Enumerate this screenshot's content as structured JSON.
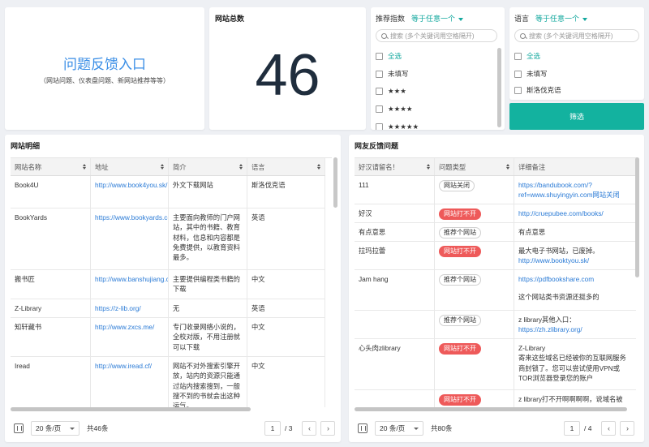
{
  "feedback": {
    "title": "问题反馈入口",
    "subtitle": "（网站问题、仪表盘问题、新网站推荐等等）"
  },
  "total": {
    "title": "网站总数",
    "value": "46"
  },
  "filter_rec": {
    "label": "推荐指数",
    "operator": "等于任意一个",
    "search_placeholder": "搜索 (多个关键词用空格隔开)",
    "options": [
      "全选",
      "未填写",
      "★★★",
      "★★★★",
      "★★★★★"
    ]
  },
  "filter_lang": {
    "label": "语言",
    "operator": "等于任意一个",
    "search_placeholder": "搜索 (多个关键词用空格隔开)",
    "options": [
      "全选",
      "未填写",
      "斯洛伐克语"
    ]
  },
  "filter_button": "筛选",
  "sites": {
    "title": "网站明细",
    "columns": [
      "网站名称",
      "地址",
      "简介",
      "语言"
    ],
    "rows": [
      [
        "Book4U",
        "http://www.book4you.sk/",
        "外文下载网站",
        "斯洛伐克语"
      ],
      [
        "BookYards",
        "https://www.bookyards.com/en/welcome",
        "主要面向教师的门户网站，其中的书籍、教育材料，信息和内容都是免费提供，以教育资料最多。",
        "英语"
      ],
      [
        "搬书匠",
        "http://www.banshujiang.cn/",
        "主要提供编程类书籍的下载",
        "中文"
      ],
      [
        "Z-Library",
        "https://z-lib.org/",
        "无",
        "英语"
      ],
      [
        "知轩藏书",
        "http://www.zxcs.me/",
        "专门收录网络小说的，全校对版，不用注册就可以下载",
        "中文"
      ],
      [
        "Iread",
        "http://www.iread.cf/",
        "网站不对外搜索引擎开放，站内的资源只能通过站内搜索搜到，一般搜不到的书就会出这种运气。",
        "中文"
      ]
    ],
    "pager": {
      "page_size": "20 条/页",
      "total": "共46条",
      "current": "1",
      "of": "/ 3"
    }
  },
  "feedbacks": {
    "title": "网友反馈问题",
    "columns": [
      "好汉请留名！",
      "问题类型",
      "详细备注"
    ],
    "rows": [
      {
        "name": "111",
        "type": "网站关闭",
        "tag": "outline",
        "note": "",
        "link": "https://bandubook.com/?ref=www.shuyingyin.com网站关闭"
      },
      {
        "name": "好汉",
        "type": "网站打不开",
        "tag": "red",
        "note": "",
        "link": "http://cruepubee.com/books/"
      },
      {
        "name": "有点意思",
        "type": "推荐个网站",
        "tag": "outline",
        "note": "有点意思",
        "link": ""
      },
      {
        "name": "拉玛拉蕾",
        "type": "网站打不开",
        "tag": "red",
        "note": "最大电子书网站，已废掉。",
        "link": "http://www.booktyou.sk/"
      },
      {
        "name": "Jam hang",
        "type": "推荐个网站",
        "tag": "outline",
        "note": "这个网站类书资源还挺多的",
        "link": "https://pdfbookshare.com"
      },
      {
        "name": "",
        "type": "推荐个网站",
        "tag": "outline",
        "note": "z library其他入口：",
        "link": "https://zh.zlibrary.org/"
      },
      {
        "name": "心头肉zlibrary",
        "type": "网站打不开",
        "tag": "red",
        "note": "Z-Library\n寄来这些域名已经被你的互联网服务商封锁了。您可以尝试使用VPN或TOR浏览器登录您的账户",
        "link": ""
      },
      {
        "name": "",
        "type": "网站打不开",
        "tag": "red",
        "note": "z library打不开啊啊啊啊，说域名被",
        "link": ""
      }
    ],
    "pager": {
      "page_size": "20 条/页",
      "total": "共80条",
      "current": "1",
      "of": "/ 4"
    }
  }
}
